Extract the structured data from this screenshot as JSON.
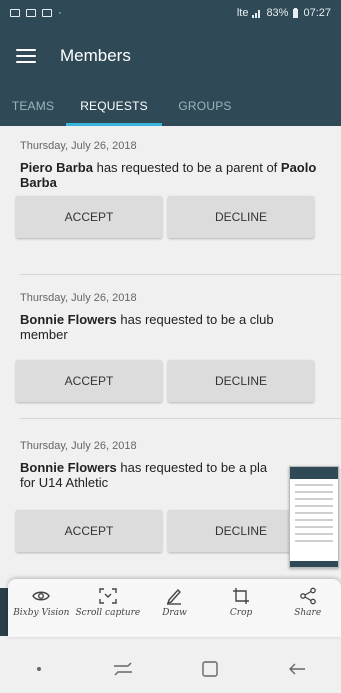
{
  "status": {
    "network": "lte",
    "battery": "83%",
    "time": "07:27"
  },
  "app_bar": {
    "title": "Members"
  },
  "tabs": [
    {
      "label": "TEAMS"
    },
    {
      "label": "REQUESTS"
    },
    {
      "label": "GROUPS"
    }
  ],
  "requests": [
    {
      "date": "Thursday, July 26, 2018",
      "name": "Piero Barba",
      "text": " has requested to be a parent of ",
      "target": "Paolo Barba",
      "accept": "ACCEPT",
      "decline": "DECLINE"
    },
    {
      "date": "Thursday, July 26, 2018",
      "name": "Bonnie Flowers",
      "text": " has requested to be a club member",
      "accept": "ACCEPT",
      "decline": "DECLINE"
    },
    {
      "date": "Thursday, July 26, 2018",
      "name": "Bonnie Flowers",
      "text": " has requested to be a pla",
      "line2": "for U14 Athletic",
      "accept": "ACCEPT",
      "decline": "DECLINE"
    }
  ],
  "screenshot_toolbar": [
    {
      "label": "Bixby Vision",
      "icon": "eye-icon"
    },
    {
      "label": "Scroll capture",
      "icon": "scroll-capture-icon"
    },
    {
      "label": "Draw",
      "icon": "pen-icon"
    },
    {
      "label": "Crop",
      "icon": "crop-icon"
    },
    {
      "label": "Share",
      "icon": "share-icon"
    }
  ],
  "colors": {
    "primary": "#2f4a56",
    "accent": "#38b4dc",
    "button": "#dcdcdc"
  }
}
